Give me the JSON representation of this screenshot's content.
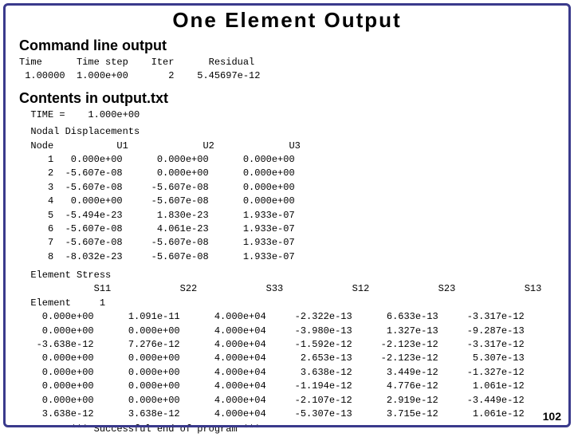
{
  "page": {
    "title": "One  Element  Output",
    "page_number": "102"
  },
  "sections": {
    "cmd_heading": "Command line output",
    "cmd_line1": "Time      Time step    Iter      Residual",
    "cmd_line2": " 1.00000  1.000e+00       2    5.45697e-12",
    "contents_heading": "Contents in output.txt",
    "time_line": "  TIME =    1.000e+00",
    "nodal_disp_heading": "  Nodal Displacements",
    "nodal_table": "  Node           U1             U2             U3\n     1   0.000e+00      0.000e+00      0.000e+00\n     2  -5.607e-08      0.000e+00      0.000e+00\n     3  -5.607e-08     -5.607e-08      0.000e+00\n     4   0.000e+00     -5.607e-08      0.000e+00\n     5  -5.494e-23      1.830e-23      1.933e-07\n     6  -5.607e-08      4.061e-23      1.933e-07\n     7  -5.607e-08     -5.607e-08      1.933e-07\n     8  -8.032e-23     -5.607e-08      1.933e-07",
    "element_stress_heading": "  Element Stress",
    "stress_table": "             S11            S22            S33            S12            S23            S13\n  Element     1\n    0.000e+00      1.091e-11      4.000e+04     -2.322e-13      6.633e-13     -3.317e-12\n    0.000e+00      0.000e+00      4.000e+04     -3.980e-13      1.327e-13     -9.287e-13\n   -3.638e-12      7.276e-12      4.000e+04     -1.592e-12     -2.123e-12     -3.317e-12\n    0.000e+00      0.000e+00      4.000e+04      2.653e-13     -2.123e-12      5.307e-13\n    0.000e+00      0.000e+00      4.000e+04      3.638e-12      3.449e-12     -1.327e-12\n    0.000e+00      0.000e+00      4.000e+04     -1.194e-12      4.776e-12      1.061e-12\n    0.000e+00      0.000e+00      4.000e+04     -2.107e-12      2.919e-12     -3.449e-12\n    3.638e-12      3.638e-12      4.000e+04     -5.307e-13      3.715e-12      1.061e-12",
    "success_line": "         *** Successful end of program ***"
  }
}
